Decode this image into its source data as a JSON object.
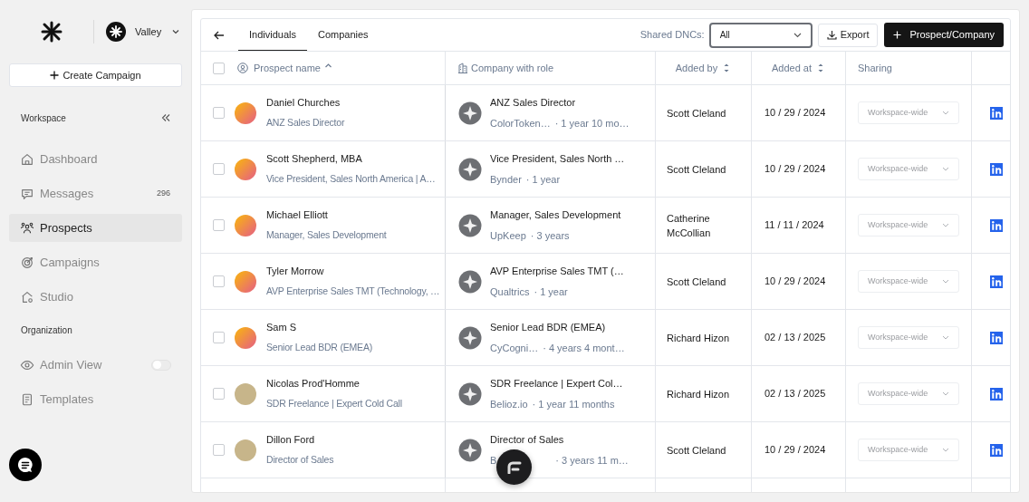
{
  "workspace_switcher": {
    "name": "Valley"
  },
  "create_button": {
    "label": "Create Campaign"
  },
  "sidebar": {
    "sections": [
      {
        "title": "Workspace",
        "items": [
          {
            "kind": "link",
            "label": "Dashboard",
            "selected": false
          },
          {
            "kind": "link",
            "label": "Messages",
            "count": "296",
            "selected": false
          },
          {
            "kind": "link",
            "label": "Prospects",
            "selected": true
          },
          {
            "kind": "link",
            "label": "Campaigns",
            "selected": false
          },
          {
            "kind": "link",
            "label": "Studio",
            "selected": false
          }
        ]
      },
      {
        "title": "Organization",
        "items": [
          {
            "kind": "toggle",
            "label": "Admin View",
            "on": false,
            "selected": false
          },
          {
            "kind": "link",
            "label": "Templates",
            "selected": false
          }
        ]
      }
    ]
  },
  "tabs": [
    {
      "label": "Individuals",
      "selected": true
    },
    {
      "label": "Companies",
      "selected": false
    }
  ],
  "filter": {
    "label": "Shared DNCs:",
    "value": "All"
  },
  "export_button": {
    "label": "Export"
  },
  "add_button": {
    "label": "Prospect/Company"
  },
  "table": {
    "select_all": {
      "checked": false
    },
    "columns": [
      {
        "label": "Prospect name"
      },
      {
        "label": "Company with role"
      },
      {
        "label": "Added by"
      },
      {
        "label": "Added at"
      },
      {
        "label": "Sharing"
      }
    ],
    "rows": [
      {
        "kind": "gradient",
        "checked": false,
        "name": "Daniel Churches",
        "headline": "ANZ Sales Director",
        "role": "ANZ Sales Director",
        "company": "ColorToken…",
        "tenure": "· 1 year 10 mo…",
        "added_by": "Scott Cleland",
        "added_at": "10 / 29 / 2024",
        "sharing": "Workspace-wide"
      },
      {
        "kind": "gradient",
        "checked": false,
        "name": "Scott Shepherd, MBA",
        "headline": "Vice President, Sales North America | A…",
        "role": "Vice President, Sales North …",
        "company": "Bynder",
        "tenure": "· 1 year",
        "added_by": "Scott Cleland",
        "added_at": "10 / 29 / 2024",
        "sharing": "Workspace-wide"
      },
      {
        "kind": "gradient",
        "checked": false,
        "name": "Michael Elliott",
        "headline": "Manager, Sales Development",
        "role": "Manager, Sales Development",
        "company": "UpKeep",
        "tenure": "· 3 years",
        "added_by": "Catherine McCollian",
        "added_at": "11 / 11 / 2024",
        "sharing": "Workspace-wide"
      },
      {
        "kind": "gradient",
        "checked": false,
        "name": "Tyler Morrow",
        "headline": "AVP Enterprise Sales TMT (Technology, …",
        "role": "AVP Enterprise Sales TMT (…",
        "company": "Qualtrics",
        "tenure": "· 1 year",
        "added_by": "Scott Cleland",
        "added_at": "10 / 29 / 2024",
        "sharing": "Workspace-wide"
      },
      {
        "kind": "gradient",
        "checked": false,
        "name": "Sam S",
        "headline": "Senior Lead BDR (EMEA)",
        "role": "Senior Lead BDR (EMEA)",
        "company": "CyCogni…",
        "tenure": "· 4 years 4 mont…",
        "added_by": "Richard Hizon",
        "added_at": "02 / 13 / 2025",
        "sharing": "Workspace-wide"
      },
      {
        "kind": "photo",
        "checked": false,
        "name": "Nicolas Prod'Homme",
        "headline": "SDR Freelance | Expert Cold Call",
        "role": "SDR Freelance | Expert Col…",
        "company": "Belioz.io",
        "tenure": "· 1 year 11 months",
        "added_by": "Richard Hizon",
        "added_at": "02 / 13 / 2025",
        "sharing": "Workspace-wide"
      },
      {
        "kind": "photo",
        "checked": false,
        "name": "Dillon Ford",
        "headline": "Director of Sales",
        "role": "Director of Sales",
        "company": "B",
        "tenure": "· 3 years 11 m…",
        "added_by": "Scott Cleland",
        "added_at": "10 / 29 / 2024",
        "sharing": "Workspace-wide"
      }
    ]
  }
}
